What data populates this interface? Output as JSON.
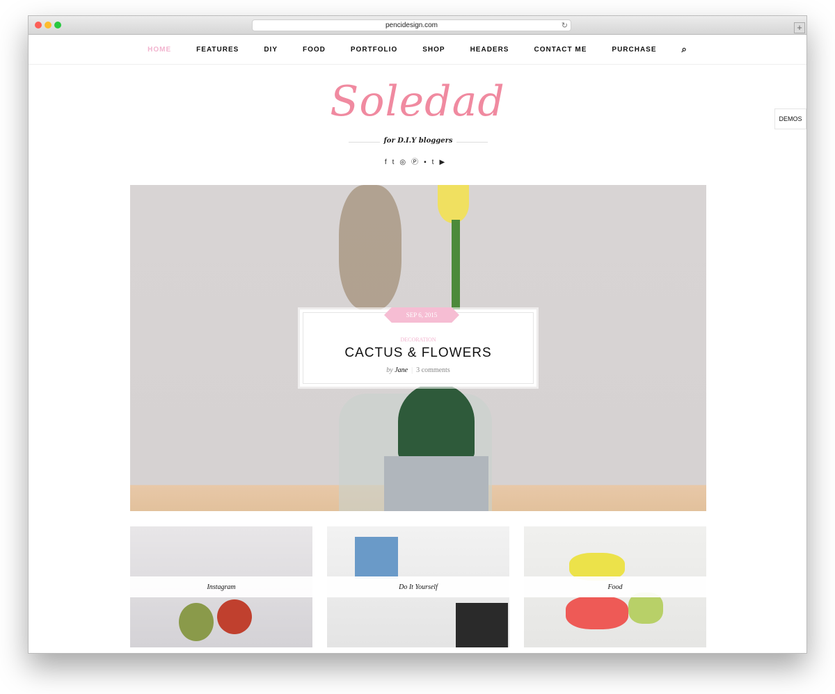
{
  "browser": {
    "url": "pencidesign.com",
    "dots": [
      "#fc5f57",
      "#fdbc2e",
      "#28c840"
    ]
  },
  "nav": {
    "items": [
      "HOME",
      "FEATURES",
      "DIY",
      "FOOD",
      "PORTFOLIO",
      "SHOP",
      "HEADERS",
      "CONTACT ME",
      "PURCHASE"
    ]
  },
  "logo": {
    "text": "Soledad",
    "tagline": "for D.I.Y bloggers"
  },
  "social": [
    "facebook",
    "twitter",
    "instagram",
    "pinterest",
    "flickr",
    "tumblr",
    "youtube"
  ],
  "demos": "DEMOS",
  "featured": {
    "date": "SEP 6, 2015",
    "category": "DECORATION",
    "title": "CACTUS & FLOWERS",
    "by": "by",
    "author": "Jane",
    "comments": "3 comments"
  },
  "categories": [
    {
      "label": "Instagram"
    },
    {
      "label": "Do It Yourself"
    },
    {
      "label": "Food"
    }
  ],
  "colors": {
    "accent": "#f2b4cf"
  }
}
